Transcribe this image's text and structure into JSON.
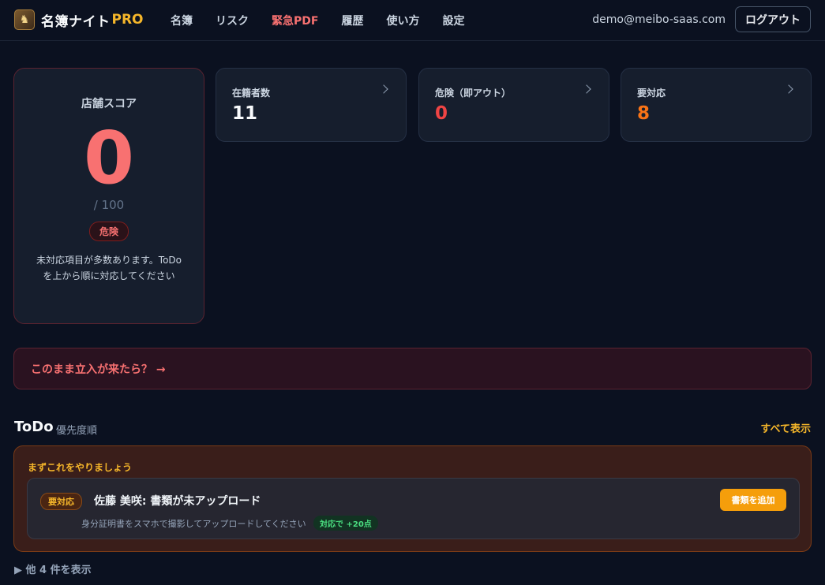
{
  "header": {
    "logo_text": "名簿ナイト",
    "logo_pro": "PRO",
    "nav": [
      "名簿",
      "リスク",
      "緊急PDF",
      "履歴",
      "使い方",
      "設定"
    ],
    "user_email": "demo@meibo-saas.com",
    "logout_label": "ログアウト"
  },
  "score": {
    "title": "店舗スコア",
    "value": "0",
    "max": "/ 100",
    "badge": "危険",
    "message": "未対応項目が多数あります。ToDoを上から順に対応してください"
  },
  "stats": [
    {
      "label": "在籍者数",
      "value": "11"
    },
    {
      "label": "危険（即アウト）",
      "value": "0"
    },
    {
      "label": "要対応",
      "value": "8"
    }
  ],
  "alert": {
    "text": "このまま立入が来たら？ →"
  },
  "todo": {
    "title": "ToDo",
    "subtitle": "優先度順",
    "show_all": "すべて表示",
    "box_title": "まずこれをやりましょう",
    "item": {
      "badge": "要対応",
      "title": "佐藤 美咲: 書類が未アップロード",
      "description": "身分証明書をスマホで撮影してアップロードしてください",
      "points": "対応で +20点",
      "action": "書類を追加"
    },
    "more": "▶ 他 4 件を表示"
  },
  "colors": {
    "accent": "#f5b62a",
    "danger": "#f87171",
    "warning": "#f97316",
    "success": "#4ade80",
    "background": "#0b1120"
  }
}
